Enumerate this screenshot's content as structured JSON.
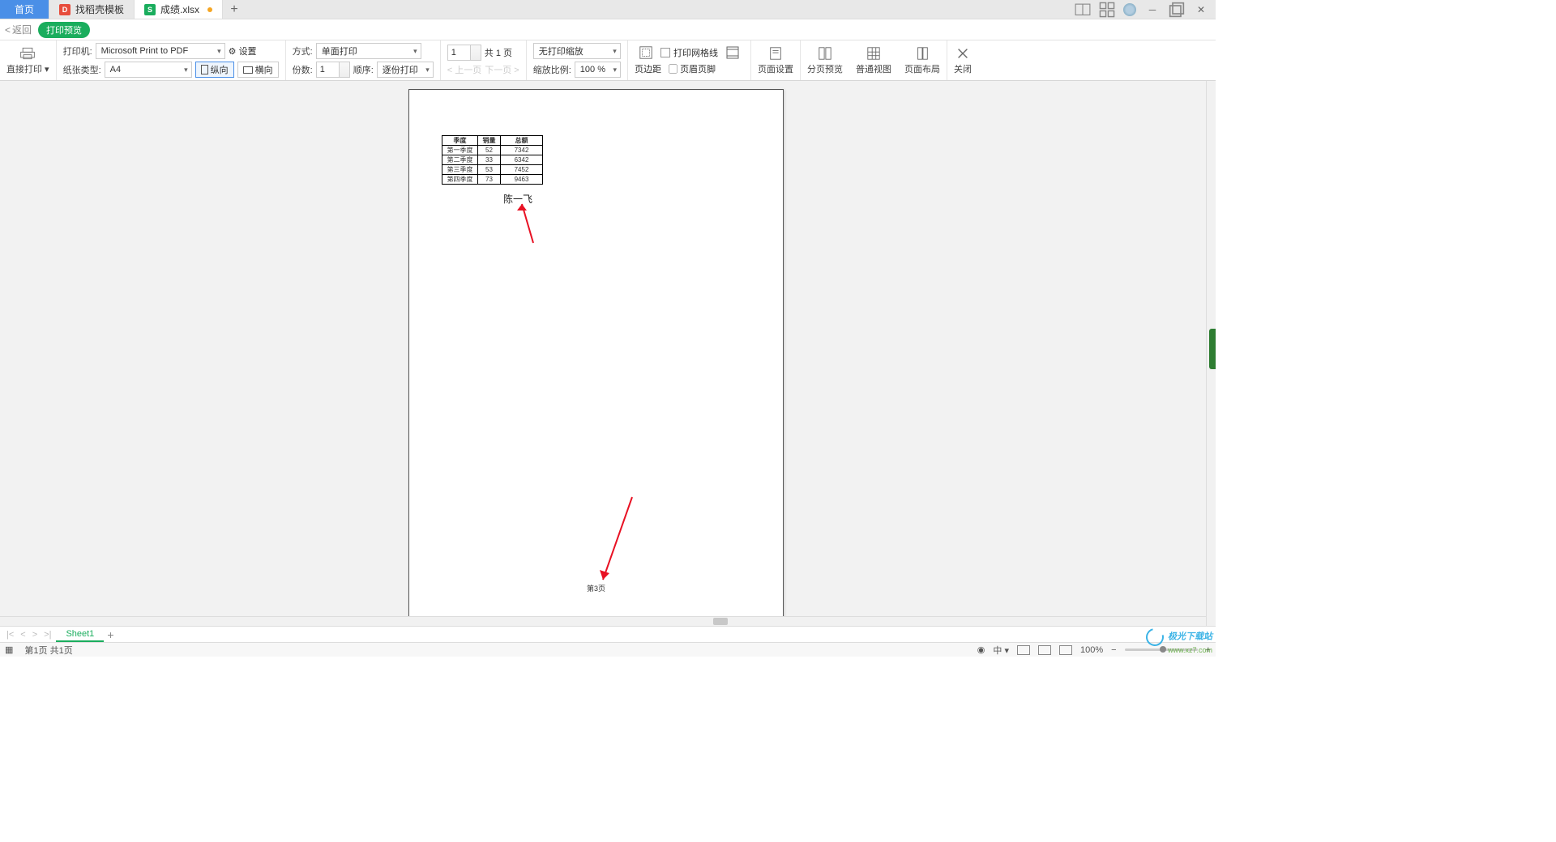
{
  "tabs": {
    "home": "首页",
    "template": "找稻壳模板",
    "file": "成绩.xlsx"
  },
  "header": {
    "back": "返回",
    "title": "打印预览"
  },
  "toolbar": {
    "direct_print": "直接打印",
    "printer_label": "打印机:",
    "printer_value": "Microsoft Print to PDF",
    "settings": "设置",
    "paper_label": "纸张类型:",
    "paper_value": "A4",
    "portrait": "纵向",
    "landscape": "横向",
    "mode_label": "方式:",
    "mode_value": "单面打印",
    "copies_label": "份数:",
    "copies_value": "1",
    "order_label": "顺序:",
    "order_value": "逐份打印",
    "page_value": "1",
    "total_pages": "共 1 页",
    "prev": "上一页",
    "next": "下一页",
    "scale_value": "无打印缩放",
    "zoom_label": "缩放比例:",
    "zoom_value": "100 %",
    "margins": "页边距",
    "gridlines": "打印网格线",
    "header_footer": "页眉页脚",
    "page_setup": "页面设置",
    "page_break": "分页预览",
    "normal_view": "普通视图",
    "page_layout": "页面布局",
    "close": "关闭"
  },
  "table": {
    "headers": [
      "季度",
      "销量",
      "总额"
    ],
    "rows": [
      [
        "第一季度",
        "52",
        "7342"
      ],
      [
        "第二季度",
        "33",
        "6342"
      ],
      [
        "第三季度",
        "53",
        "7452"
      ],
      [
        "第四季度",
        "73",
        "9463"
      ]
    ]
  },
  "page": {
    "signature": "陈一飞",
    "footer": "第3页"
  },
  "sheets": {
    "name": "Sheet1"
  },
  "status": {
    "pages": "第1页 共1页",
    "lang": "中",
    "zoom": "100%"
  },
  "watermark": {
    "line1": "极光下载站",
    "line2": "www.xz7.com"
  }
}
